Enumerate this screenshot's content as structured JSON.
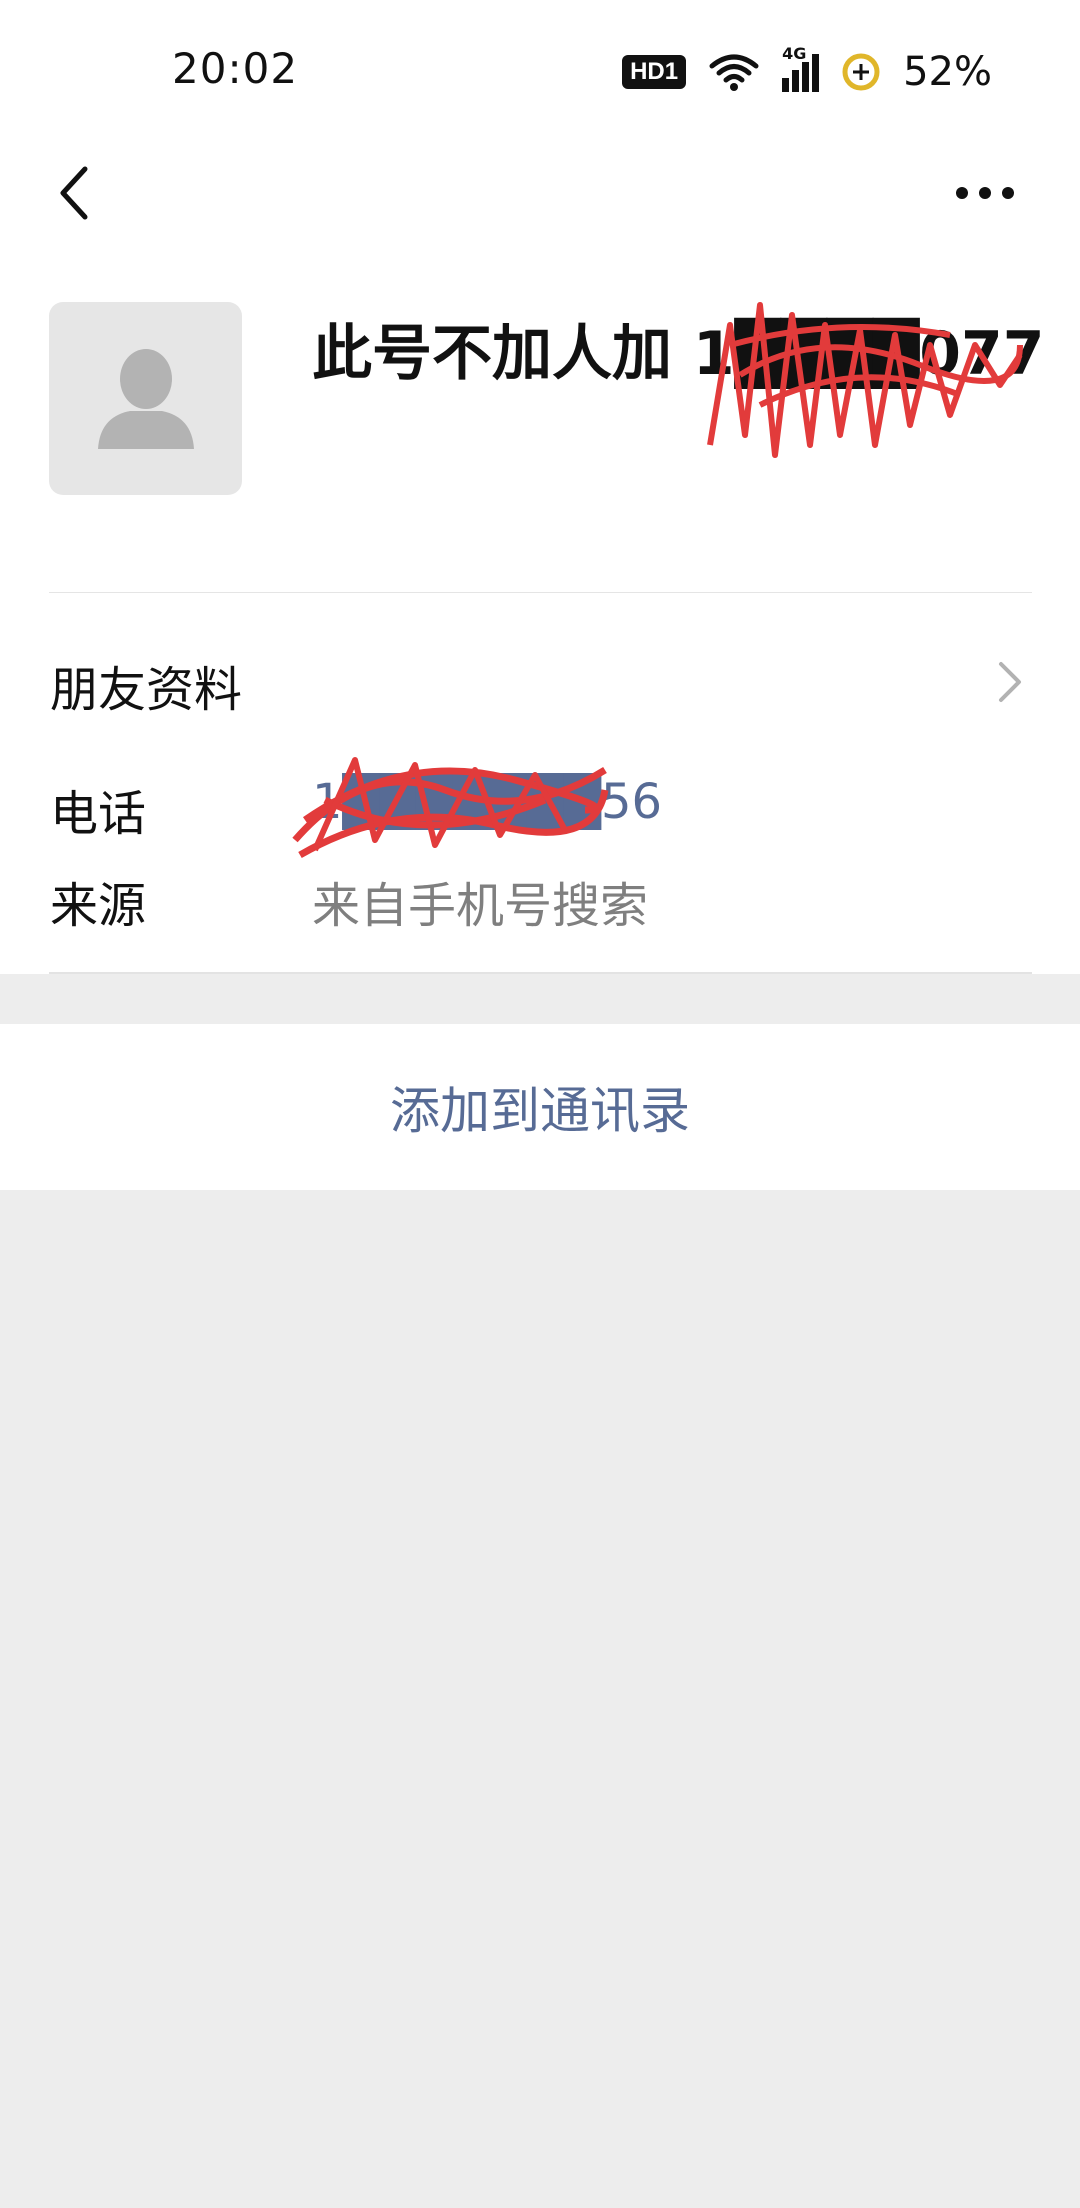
{
  "status_bar": {
    "time": "20:02",
    "hd_badge": "HD1",
    "network_label": "4G",
    "battery": "52%",
    "icons": [
      "hd-icon",
      "wifi-icon",
      "signal-icon",
      "battery-saver-icon"
    ]
  },
  "nav": {
    "back_icon": "chevron-left-icon",
    "more_icon": "more-dots-icon"
  },
  "profile": {
    "avatar_icon": "default-avatar-icon",
    "name": "此号不加人加 1████077"
  },
  "friend_info": {
    "label": "朋友资料",
    "chevron_icon": "chevron-right-icon"
  },
  "details": {
    "phone_label": "电话",
    "phone_value": "1███████56",
    "source_label": "来源",
    "source_value": "来自手机号搜索"
  },
  "actions": {
    "add_to_contacts": "添加到通讯录"
  },
  "colors": {
    "link_blue": "#576b95",
    "muted_text": "#7f7f7f",
    "page_bg": "#ededed",
    "redaction_red": "#e23b3b"
  }
}
